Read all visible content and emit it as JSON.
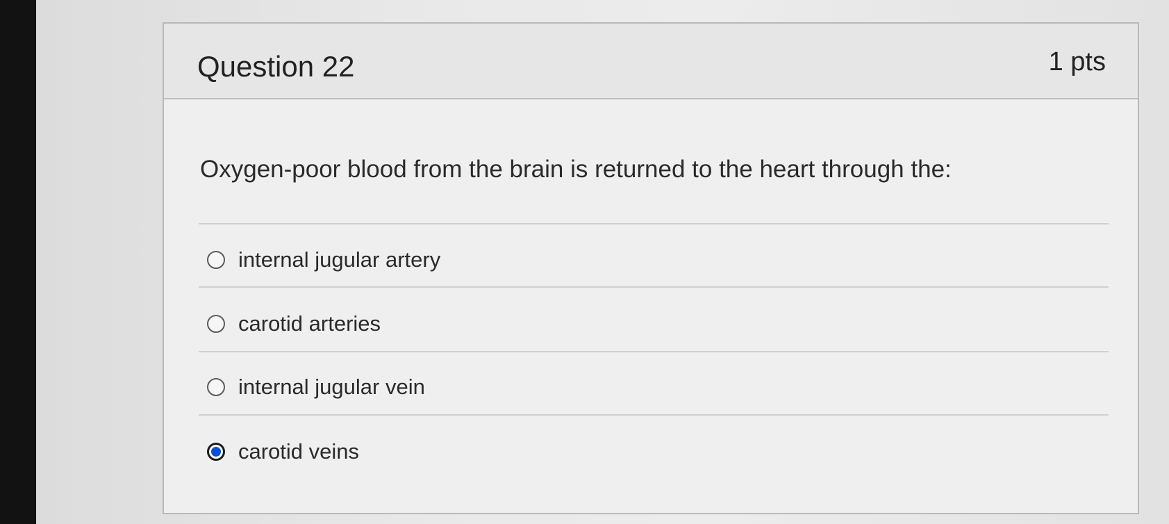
{
  "question": {
    "title": "Question 22",
    "points": "1 pts",
    "text": "Oxygen-poor blood from the brain is returned to the heart through the:"
  },
  "answers": [
    {
      "label": "internal jugular artery",
      "selected": false
    },
    {
      "label": "carotid arteries",
      "selected": false
    },
    {
      "label": "internal jugular vein",
      "selected": false
    },
    {
      "label": "carotid veins",
      "selected": true
    }
  ],
  "colors": {
    "selected_radio": "#0b4fd6"
  }
}
